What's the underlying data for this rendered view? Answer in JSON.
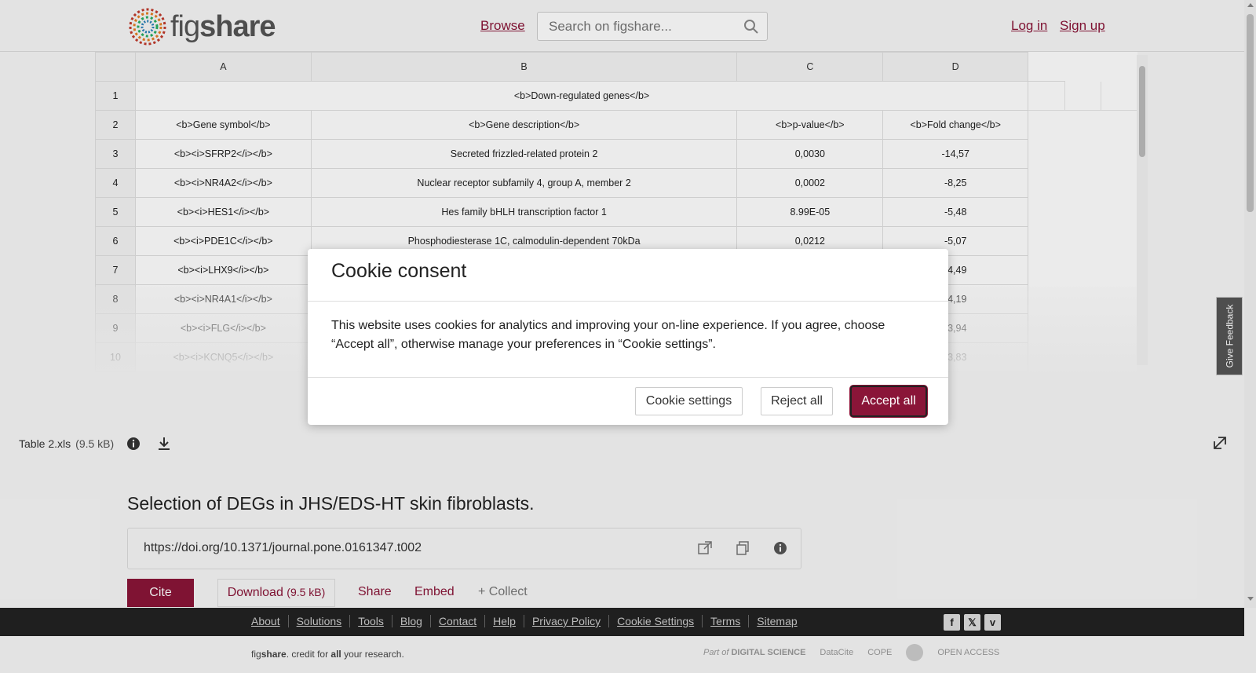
{
  "header": {
    "logo_text_light": "fig",
    "logo_text_bold": "share",
    "browse": "Browse",
    "search_placeholder": "Search on figshare...",
    "login": "Log in",
    "signup": "Sign up"
  },
  "sheet": {
    "columns": [
      "",
      "A",
      "B",
      "C",
      "D"
    ],
    "rows": [
      {
        "num": "1",
        "merged": "<b>Down-regulated genes</b>"
      },
      {
        "num": "2",
        "cells": [
          "<b>Gene symbol</b>",
          "<b>Gene description</b>",
          "<b>p-value</b>",
          "<b>Fold change</b>"
        ]
      },
      {
        "num": "3",
        "cells": [
          "<b><i>SFRP2</i></b>",
          "Secreted frizzled-related protein 2",
          "0,0030",
          "-14,57"
        ]
      },
      {
        "num": "4",
        "cells": [
          "<b><i>NR4A2</i></b>",
          "Nuclear receptor subfamily 4, group A, member 2",
          "0,0002",
          "-8,25"
        ]
      },
      {
        "num": "5",
        "cells": [
          "<b><i>HES1</i></b>",
          "Hes family bHLH transcription factor 1",
          "8.99E-05",
          "-5,48"
        ]
      },
      {
        "num": "6",
        "cells": [
          "<b><i>PDE1C</i></b>",
          "Phosphodiesterase 1C, calmodulin-dependent 70kDa",
          "0,0212",
          "-5,07"
        ]
      },
      {
        "num": "7",
        "cells": [
          "<b><i>LHX9</i></b>",
          "",
          "",
          "-4,49"
        ]
      },
      {
        "num": "8",
        "cells": [
          "<b><i>NR4A1</i></b>",
          "",
          "",
          "-4,19"
        ]
      },
      {
        "num": "9",
        "cells": [
          "<b><i>FLG</i></b>",
          "",
          "",
          "-3,94"
        ]
      },
      {
        "num": "10",
        "cells": [
          "<b><i>KCNQ5</i></b>",
          "",
          "",
          "-3,83"
        ]
      }
    ]
  },
  "file": {
    "name": "Table 2.xls",
    "size": "(9.5 kB)"
  },
  "item": {
    "title": "Selection of DEGs in JHS/EDS-HT skin fibroblasts.",
    "doi": "https://doi.org/10.1371/journal.pone.0161347.t002",
    "cite": "Cite",
    "download": "Download",
    "download_size": "(9.5 kB)",
    "share": "Share",
    "embed": "Embed",
    "collect": "+ Collect"
  },
  "footer": {
    "links": [
      "About",
      "Solutions",
      "Tools",
      "Blog",
      "Contact",
      "Help",
      "Privacy Policy",
      "Cookie Settings",
      "Terms",
      "Sitemap"
    ],
    "tagline_fig": "fig",
    "tagline_share": "share",
    "tagline_mid": ". credit for ",
    "tagline_all": "all",
    "tagline_end": " your research.",
    "part_of": "Part of",
    "digital_science": "DIGITAL SCIENCE",
    "datacite": "DataCite",
    "cope": "COPE",
    "open_access": "OPEN ACCESS"
  },
  "feedback": "Give Feedback",
  "cookie": {
    "title": "Cookie consent",
    "body": "This website uses cookies for analytics and improving your on-line experience. If you agree, choose “Accept all”, otherwise manage your preferences in “Cookie settings”.",
    "settings": "Cookie settings",
    "reject": "Reject all",
    "accept": "Accept all"
  },
  "colors": {
    "brand": "#8a1538",
    "footer_bg": "#222222"
  }
}
